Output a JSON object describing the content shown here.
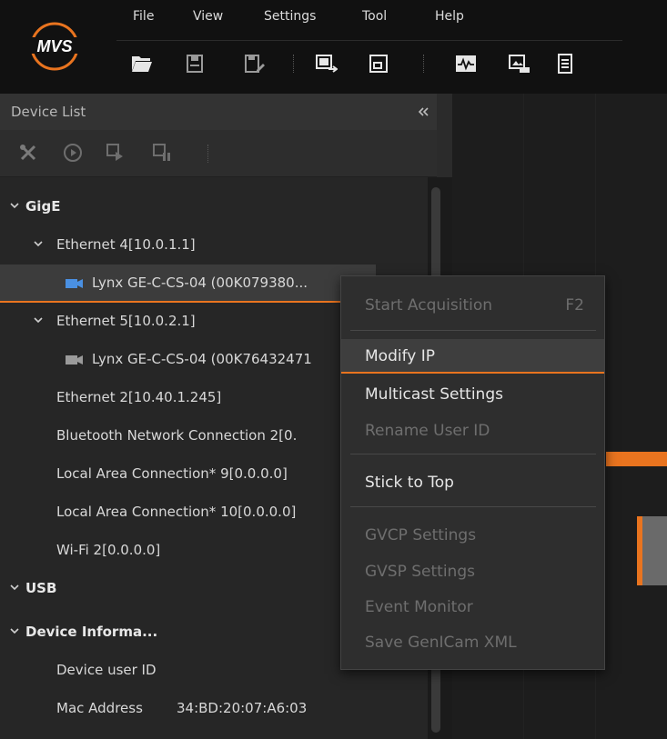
{
  "menubar": {
    "items": [
      "File",
      "View",
      "Settings",
      "Tool",
      "Help"
    ]
  },
  "toolbar": {
    "icons": [
      "open-folder-icon",
      "save-icon",
      "save-as-icon",
      "switch-view-icon",
      "window-icon",
      "waveform-icon",
      "image-settings-icon",
      "log-icon"
    ]
  },
  "device_panel": {
    "title": "Device List",
    "tools": [
      "tools-icon",
      "play-icon",
      "start-all-icon",
      "stop-all-icon"
    ]
  },
  "tree": {
    "gige": "GigE",
    "eth4": "Ethernet 4[10.0.1.1]",
    "cam1": "Lynx GE-C-CS-04 (00K079380...",
    "eth5": "Ethernet 5[10.0.2.1]",
    "cam2": "Lynx GE-C-CS-04 (00K76432471",
    "eth2": "Ethernet 2[10.40.1.245]",
    "bluetooth": "Bluetooth Network Connection 2[0.",
    "lac9": "Local Area Connection* 9[0.0.0.0]",
    "lac10": "Local Area Connection* 10[0.0.0.0]",
    "wifi2": "Wi-Fi 2[0.0.0.0]",
    "usb": "USB",
    "devinfo": "Device Informa...",
    "user_id_label": "Device user ID",
    "mac_label": "Mac Address",
    "mac_value": "34:BD:20:07:A6:03"
  },
  "context_menu": {
    "start_acq": "Start Acquisition",
    "start_acq_shortcut": "F2",
    "modify_ip": "Modify IP",
    "multicast": "Multicast Settings",
    "rename": "Rename User ID",
    "stick_top": "Stick to Top",
    "gvcp": "GVCP Settings",
    "gvsp": "GVSP Settings",
    "event_monitor": "Event Monitor",
    "save_xml": "Save GenICam XML"
  },
  "colors": {
    "accent": "#e9741f",
    "camera_active": "#4a90e2"
  }
}
